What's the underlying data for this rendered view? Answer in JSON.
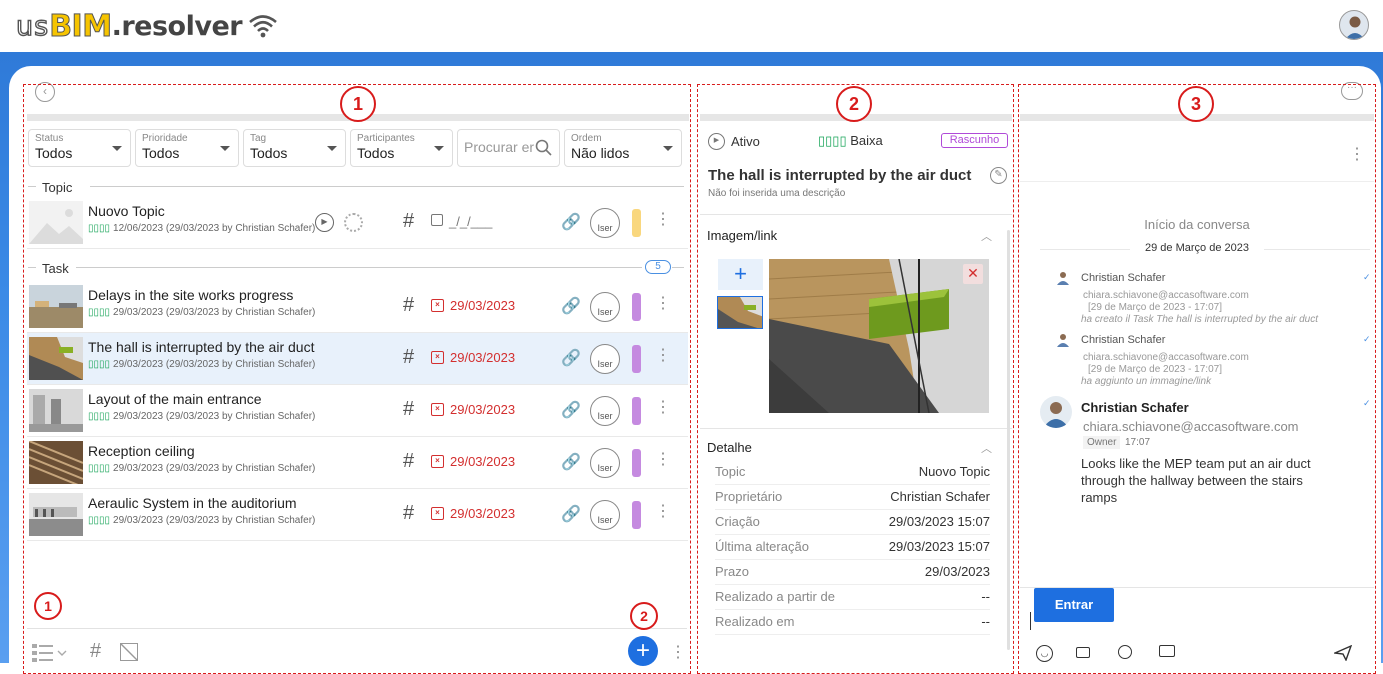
{
  "app": {
    "logo_us": "us",
    "logo_bim": "BIM",
    "logo_rest": ".resolver"
  },
  "markers": {
    "p1": "1",
    "p2": "2",
    "p3": "3",
    "b1": "1",
    "b2": "2"
  },
  "filters": [
    {
      "label": "Status",
      "value": "Todos"
    },
    {
      "label": "Prioridade",
      "value": "Todos"
    },
    {
      "label": "Tag",
      "value": "Todos"
    },
    {
      "label": "Participantes",
      "value": "Todos"
    },
    {
      "label": "Ordem",
      "value": "Não lidos"
    }
  ],
  "search": {
    "placeholder": "Procurar er"
  },
  "sections": {
    "topic": "Topic",
    "task": "Task",
    "task_count": "5"
  },
  "topic_row": {
    "title": "Nuovo Topic",
    "prio": "▯▯▯▯",
    "sub": "12/06/2023 (29/03/2023 by Christian Schafer)",
    "date": "_/_/___",
    "user": "Iser",
    "color": "#f9d77e"
  },
  "tasks": [
    {
      "title": "Delays in the site works progress",
      "prio": "▯▯▯▯",
      "sub": "29/03/2023 (29/03/2023 by Christian Schafer)",
      "date": "29/03/2023",
      "user": "Iser",
      "color": "#c58ae0"
    },
    {
      "title": "The hall is interrupted by the air duct",
      "prio": "▯▯▯▯",
      "sub": "29/03/2023 (29/03/2023 by Christian Schafer)",
      "date": "29/03/2023",
      "user": "Iser",
      "color": "#c58ae0"
    },
    {
      "title": "Layout of the main entrance",
      "prio": "▯▯▯▯",
      "sub": "29/03/2023 (29/03/2023 by Christian Schafer)",
      "date": "29/03/2023",
      "user": "Iser",
      "color": "#c58ae0"
    },
    {
      "title": "Reception ceiling",
      "prio": "▯▯▯▯",
      "sub": "29/03/2023 (29/03/2023 by Christian Schafer)",
      "date": "29/03/2023",
      "user": "Iser",
      "color": "#c58ae0"
    },
    {
      "title": "Aeraulic System in the auditorium",
      "prio": "▯▯▯▯",
      "sub": "29/03/2023 (29/03/2023 by Christian Schafer)",
      "date": "29/03/2023",
      "user": "Iser",
      "color": "#c58ae0"
    }
  ],
  "detail": {
    "status": "Ativo",
    "priority_icon": "▯▯▯▯",
    "priority": "Baixa",
    "badge": "Rascunho",
    "title": "The hall is interrupted by the air duct",
    "description": "Não foi inserida uma descrição",
    "image_section": "Imagem/link",
    "detail_section": "Detalhe",
    "fields": [
      {
        "key": "Topic",
        "value": "Nuovo Topic"
      },
      {
        "key": "Proprietário",
        "value": "Christian Schafer"
      },
      {
        "key": "Criação",
        "value": "29/03/2023 15:07"
      },
      {
        "key": "Última alteração",
        "value": "29/03/2023 15:07"
      },
      {
        "key": "Prazo",
        "value": "29/03/2023"
      },
      {
        "key": "Realizado a partir de",
        "value": "--"
      },
      {
        "key": "Realizado em",
        "value": "--"
      }
    ]
  },
  "chat": {
    "start": "Início da conversa",
    "date": "29 de Março de 2023",
    "log1": {
      "name": "Christian Schafer",
      "email": "chiara.schiavone@accasoftware.com",
      "time": "[29 de Março de 2023 - 17:07]",
      "action": "ha creato il Task The hall is interrupted by the air duct"
    },
    "log2": {
      "name": "Christian Schafer",
      "email": "chiara.schiavone@accasoftware.com",
      "time": "[29 de Março de 2023 - 17:07]",
      "action": "ha aggiunto un immagine/link"
    },
    "msg": {
      "name": "Christian Schafer",
      "email": "chiara.schiavone@accasoftware.com",
      "role": "Owner",
      "time": "17:07",
      "text": "Looks like the MEP team put an air duct through the hallway between the stairs ramps"
    },
    "enter": "Entrar"
  }
}
